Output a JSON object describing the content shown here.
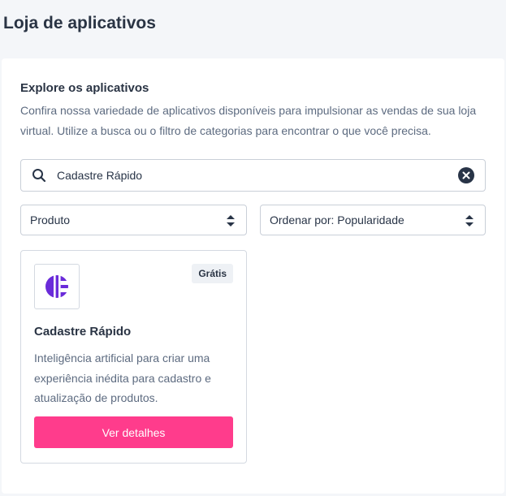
{
  "header": {
    "title": "Loja de aplicativos"
  },
  "explore": {
    "title": "Explore os aplicativos",
    "description": "Confira nossa variedade de aplicativos disponíveis para impulsionar as vendas de sua loja virtual. Utilize a busca ou o filtro de categorias para encontrar o que você precisa."
  },
  "search": {
    "value": "Cadastre Rápido",
    "icon": "search-icon",
    "clear_icon": "clear-icon"
  },
  "filters": {
    "category": "Produto",
    "sort": "Ordenar por: Popularidade"
  },
  "apps": [
    {
      "name": "Cadastre Rápido",
      "badge": "Grátis",
      "description": "Inteligência artificial para criar uma experiência inédita para cadastro e atualização de produtos.",
      "button_label": "Ver detalhes",
      "logo_icon": "cadastre-rapido-logo",
      "logo_color": "#6a2bd9"
    }
  ],
  "colors": {
    "accent": "#ff3c8c",
    "background": "#f4f6f9",
    "text": "#2a3444",
    "muted": "#5d6b80"
  }
}
